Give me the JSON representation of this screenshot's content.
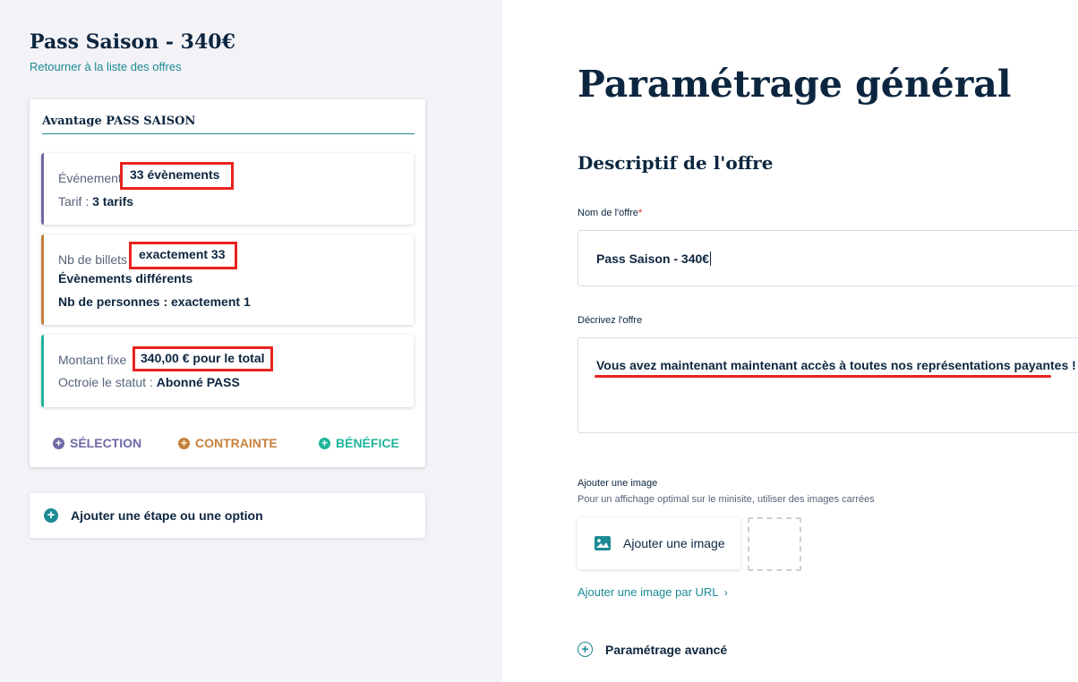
{
  "sidebar": {
    "offer_title": "Pass Saison - 340€",
    "back_link": "Retourner à la liste des offres",
    "card": {
      "title": "Avantage PASS SAISON",
      "rules": [
        {
          "line1_label": "Événement",
          "line1_value": "33 évènements",
          "line2_label": "Tarif :",
          "line2_value": "3 tarifs",
          "accent": "#6e6aa6"
        },
        {
          "line1_label": "Nb de billets",
          "line1_value": "exactement 33",
          "line2_text": "Évènements différents",
          "line3_text": "Nb de personnes : exactement 1",
          "accent": "#c7803a"
        },
        {
          "line1_label": "Montant fixe",
          "line1_value": "340,00 € pour le total",
          "line2_label": "Octroie le statut :",
          "line2_value": "Abonné PASS",
          "accent": "#1fb59a"
        }
      ],
      "actions": [
        {
          "label": "SÉLECTION",
          "color": "#6e6aa6",
          "icon": "plus-circle-icon"
        },
        {
          "label": "CONTRAINTE",
          "color": "#c7803a",
          "icon": "plus-circle-icon"
        },
        {
          "label": "BÉNÉFICE",
          "color": "#1fb59a",
          "icon": "plus-circle-icon"
        }
      ]
    },
    "add_step_label": "Ajouter une étape ou une option"
  },
  "main": {
    "title": "Paramétrage général",
    "section_title": "Descriptif de l'offre",
    "offer_name": {
      "label": "Nom de l'offre",
      "required_mark": "*",
      "value": "Pass Saison  - 340€"
    },
    "description": {
      "label": "Décrivez l'offre",
      "value": "Vous avez maintenant maintenant accès à toutes nos représentations payantes !"
    },
    "image": {
      "label": "Ajouter une image",
      "hint": "Pour un affichage optimal sur le minisite, utiliser des images carrées",
      "button_label": "Ajouter une image",
      "url_link": "Ajouter une image par URL",
      "url_chevron": "›"
    },
    "advanced_label": "Paramétrage avancé"
  },
  "colors": {
    "highlight": "#e8231f",
    "link": "#1a8a93",
    "text": "#0d2640"
  }
}
